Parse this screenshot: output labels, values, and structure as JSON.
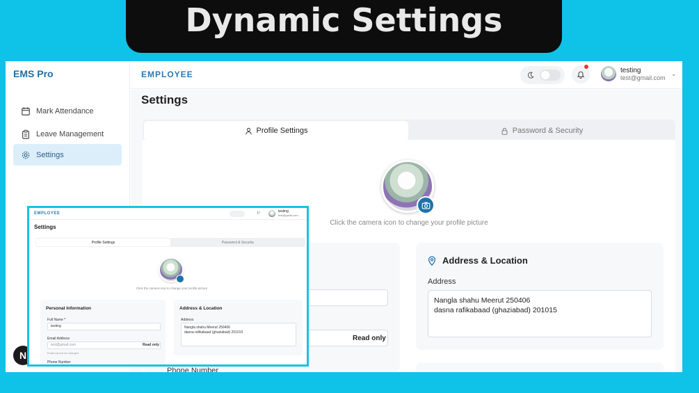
{
  "banner": {
    "title": "Dynamic Settings"
  },
  "sidebar": {
    "brand": "EMS Pro",
    "items": [
      {
        "label": "Mark Attendance",
        "icon": "calendar-icon"
      },
      {
        "label": "Leave Management",
        "icon": "clipboard-icon"
      },
      {
        "label": "Settings",
        "icon": "gear-icon",
        "active": true
      }
    ]
  },
  "header": {
    "section": "EMPLOYEE",
    "user_name": "testing",
    "user_email": "test@gmail.com"
  },
  "page": {
    "title": "Settings",
    "tabs": [
      {
        "label": "Profile Settings",
        "icon": "user-icon",
        "active": true
      },
      {
        "label": "Password & Security",
        "icon": "lock-icon"
      }
    ],
    "avatar_hint": "Click the camera icon to change your profile picture",
    "address_section": {
      "title": "Address & Location",
      "label": "Address",
      "value": "Nangla shahu Meerut 250406\ndasna rafikabaad (ghaziabad) 201015"
    },
    "email_readonly": "Read only",
    "phone_label": "Phone Number"
  },
  "inset": {
    "section": "EMPLOYEE",
    "user_name": "testing",
    "user_email": "test@gmail.com",
    "title": "Settings",
    "tabs": [
      "Profile Settings",
      "Password & Security"
    ],
    "hint": "Click the camera icon to change your profile picture",
    "personal_title": "Personal Information",
    "full_name_label": "Full Name *",
    "full_name_value": "testing",
    "email_label": "Email Address",
    "email_value": "test@gmail.com",
    "read_only": "Read only",
    "email_note": "Email cannot be changed",
    "phone_label": "Phone Number",
    "address_title": "Address & Location",
    "address_label": "Address",
    "address_value": "Nangla shahu Meerut 250406\ndasna rafikabaad (ghaziabad) 201015"
  },
  "colors": {
    "accent": "#1d73a8",
    "banner_bg": "#0d0d0d",
    "page_bg": "#0fc2e8",
    "active_nav": "#ddeefb"
  }
}
